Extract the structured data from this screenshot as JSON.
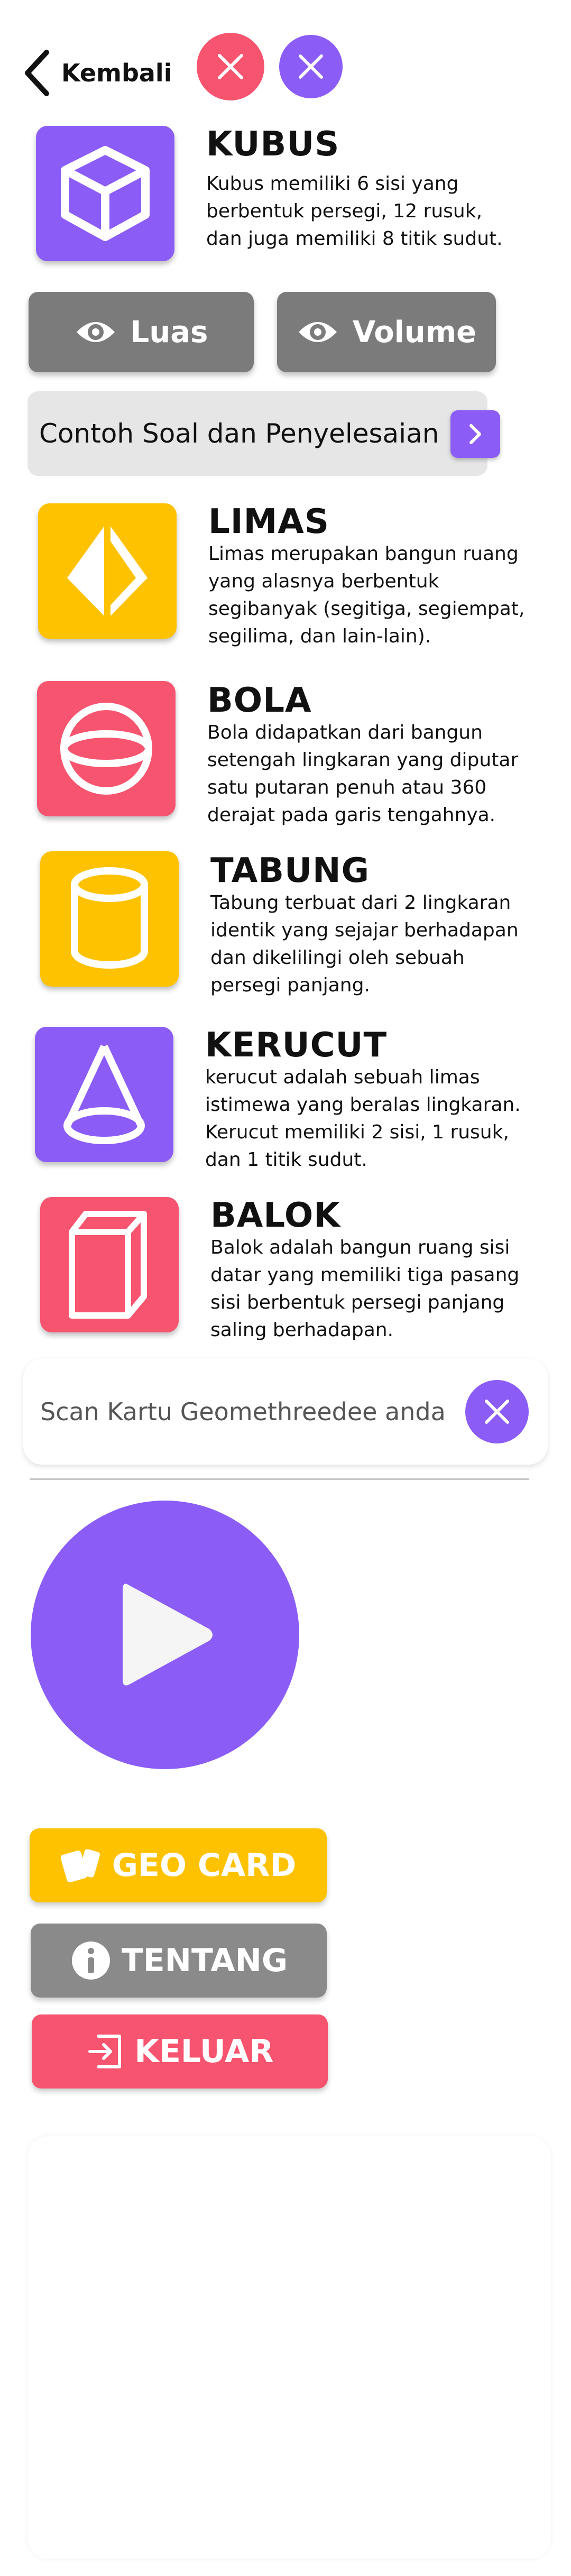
{
  "header": {
    "back_label": "Kembali"
  },
  "featured": {
    "title": "KUBUS",
    "description": "Kubus memiliki 6 sisi yang berbentuk persegi, 12 rusuk, dan juga memiliki 8 titik sudut."
  },
  "actions": {
    "luas_label": "Luas",
    "volume_label": "Volume",
    "contoh_label": "Contoh Soal dan Penyelesaian"
  },
  "shapes": [
    {
      "title": "LIMAS",
      "description": "Limas merupakan bangun ruang yang alasnya berbentuk segibanyak (segitiga, segiempat, segilima, dan lain-lain).",
      "color": "#fec200",
      "icon": "pyramid-icon"
    },
    {
      "title": "BOLA",
      "description": "Bola didapatkan dari bangun setengah lingkaran yang diputar satu putaran penuh atau 360 derajat pada garis tengahnya.",
      "color": "#f75470",
      "icon": "sphere-icon"
    },
    {
      "title": "TABUNG",
      "description": "Tabung terbuat dari 2 lingkaran identik yang sejajar berhadapan dan dikelilingi oleh sebuah persegi panjang.",
      "color": "#fec200",
      "icon": "cylinder-icon"
    },
    {
      "title": "KERUCUT",
      "description": "kerucut adalah sebuah limas istimewa yang beralas lingkaran. Kerucut memiliki 2 sisi, 1 rusuk, dan 1 titik sudut.",
      "color": "#8b5cf6",
      "icon": "cone-icon"
    },
    {
      "title": "BALOK",
      "description": "Balok adalah bangun ruang sisi datar yang memiliki tiga pasang sisi berbentuk persegi panjang saling berhadapan.",
      "color": "#f75470",
      "icon": "cuboid-icon"
    }
  ],
  "scan": {
    "text": "Scan Kartu Geomethreedee anda"
  },
  "menu": {
    "geocard_label": "GEO CARD",
    "tentang_label": "TENTANG",
    "keluar_label": "KELUAR"
  },
  "colors": {
    "purple": "#8b5cf6",
    "yellow": "#fec200",
    "pink": "#f75470",
    "gray": "#7b7b7b"
  }
}
